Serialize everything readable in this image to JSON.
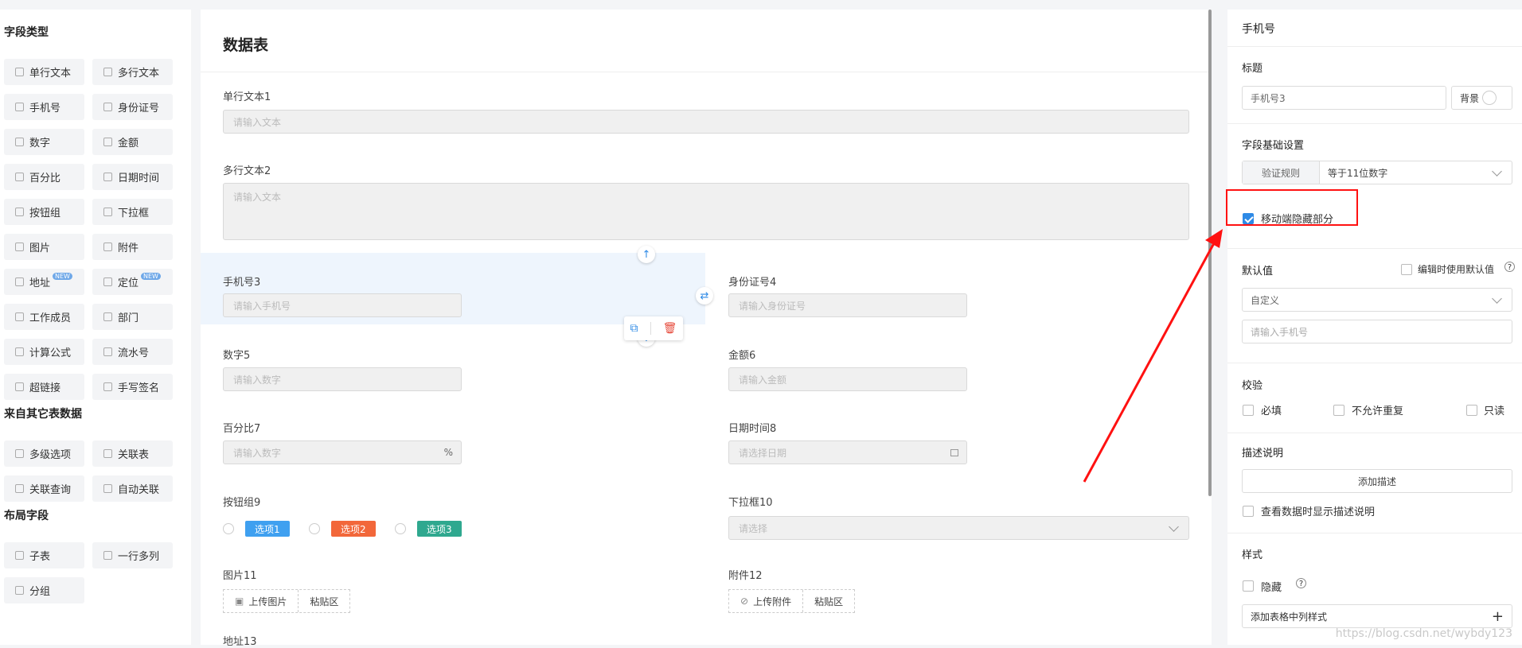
{
  "left_panel": {
    "sections": [
      {
        "title": "字段类型",
        "items": [
          {
            "label": "单行文本",
            "icon": "text-line-icon"
          },
          {
            "label": "多行文本",
            "icon": "text-area-icon"
          },
          {
            "label": "手机号",
            "icon": "phone-icon"
          },
          {
            "label": "身份证号",
            "icon": "id-card-icon"
          },
          {
            "label": "数字",
            "icon": "number-icon"
          },
          {
            "label": "金额",
            "icon": "money-icon"
          },
          {
            "label": "百分比",
            "icon": "percent-icon"
          },
          {
            "label": "日期时间",
            "icon": "calendar-icon"
          },
          {
            "label": "按钮组",
            "icon": "radio-icon"
          },
          {
            "label": "下拉框",
            "icon": "dropdown-icon"
          },
          {
            "label": "图片",
            "icon": "image-icon"
          },
          {
            "label": "附件",
            "icon": "attachment-icon"
          },
          {
            "label": "地址",
            "icon": "location-icon",
            "badge": "NEW"
          },
          {
            "label": "定位",
            "icon": "locate-icon",
            "badge": "NEW"
          },
          {
            "label": "工作成员",
            "icon": "member-icon"
          },
          {
            "label": "部门",
            "icon": "department-icon"
          },
          {
            "label": "计算公式",
            "icon": "formula-icon"
          },
          {
            "label": "流水号",
            "icon": "serial-icon"
          },
          {
            "label": "超链接",
            "icon": "link-icon"
          },
          {
            "label": "手写签名",
            "icon": "signature-icon"
          }
        ]
      },
      {
        "title": "来自其它表数据",
        "items": [
          {
            "label": "多级选项",
            "icon": "multi-level-icon"
          },
          {
            "label": "关联表",
            "icon": "relation-table-icon"
          },
          {
            "label": "关联查询",
            "icon": "relation-query-icon"
          },
          {
            "label": "自动关联",
            "icon": "auto-relation-icon"
          }
        ]
      },
      {
        "title": "布局字段",
        "items": [
          {
            "label": "子表",
            "icon": "subtable-icon"
          },
          {
            "label": "一行多列",
            "icon": "columns-icon"
          },
          {
            "label": "分组",
            "icon": "group-icon"
          }
        ]
      }
    ]
  },
  "center": {
    "title": "数据表",
    "fields": {
      "f1": {
        "label": "单行文本1",
        "placeholder": "请输入文本"
      },
      "f2": {
        "label": "多行文本2",
        "placeholder": "请输入文本"
      },
      "f3": {
        "label": "手机号3",
        "placeholder": "请输入手机号"
      },
      "f4": {
        "label": "身份证号4",
        "placeholder": "请输入身份证号"
      },
      "f5": {
        "label": "数字5",
        "placeholder": "请输入数字"
      },
      "f6": {
        "label": "金额6",
        "placeholder": "请输入金额"
      },
      "f7": {
        "label": "百分比7",
        "placeholder": "请输入数字",
        "suffix": "%"
      },
      "f8": {
        "label": "日期时间8",
        "placeholder": "请选择日期"
      },
      "f9": {
        "label": "按钮组9",
        "options": [
          {
            "label": "选项1",
            "color": "#3fa0f0"
          },
          {
            "label": "选项2",
            "color": "#f2673a"
          },
          {
            "label": "选项3",
            "color": "#2fa88f"
          }
        ]
      },
      "f10": {
        "label": "下拉框10",
        "placeholder": "请选择"
      },
      "f11": {
        "label": "图片11",
        "upload": "上传图片",
        "paste": "粘贴区"
      },
      "f12": {
        "label": "附件12",
        "upload": "上传附件",
        "paste": "粘贴区"
      },
      "f13": {
        "label": "地址13"
      }
    }
  },
  "right_panel": {
    "header": "手机号",
    "title_section": {
      "label": "标题",
      "value": "手机号3",
      "bg_label": "背景"
    },
    "basic": {
      "label": "字段基础设置",
      "rule_tab": "验证规则",
      "rule_value": "等于11位数字",
      "mobile_hide": "移动端隐藏部分",
      "mobile_hide_checked": true
    },
    "default": {
      "label": "默认值",
      "edit_default": "编辑时使用默认值",
      "mode": "自定义",
      "placeholder": "请输入手机号"
    },
    "validate": {
      "label": "校验",
      "required": "必填",
      "no_dup": "不允许重复",
      "readonly": "只读"
    },
    "desc": {
      "label": "描述说明",
      "add_btn": "添加描述",
      "show_desc": "查看数据时显示描述说明"
    },
    "style": {
      "label": "样式",
      "hide": "隐藏",
      "add_col_style": "添加表格中列样式"
    }
  },
  "watermark": "https://blog.csdn.net/wybdy123",
  "colors": {
    "accent": "#2e8ae6",
    "annotation": "#ff1111"
  }
}
